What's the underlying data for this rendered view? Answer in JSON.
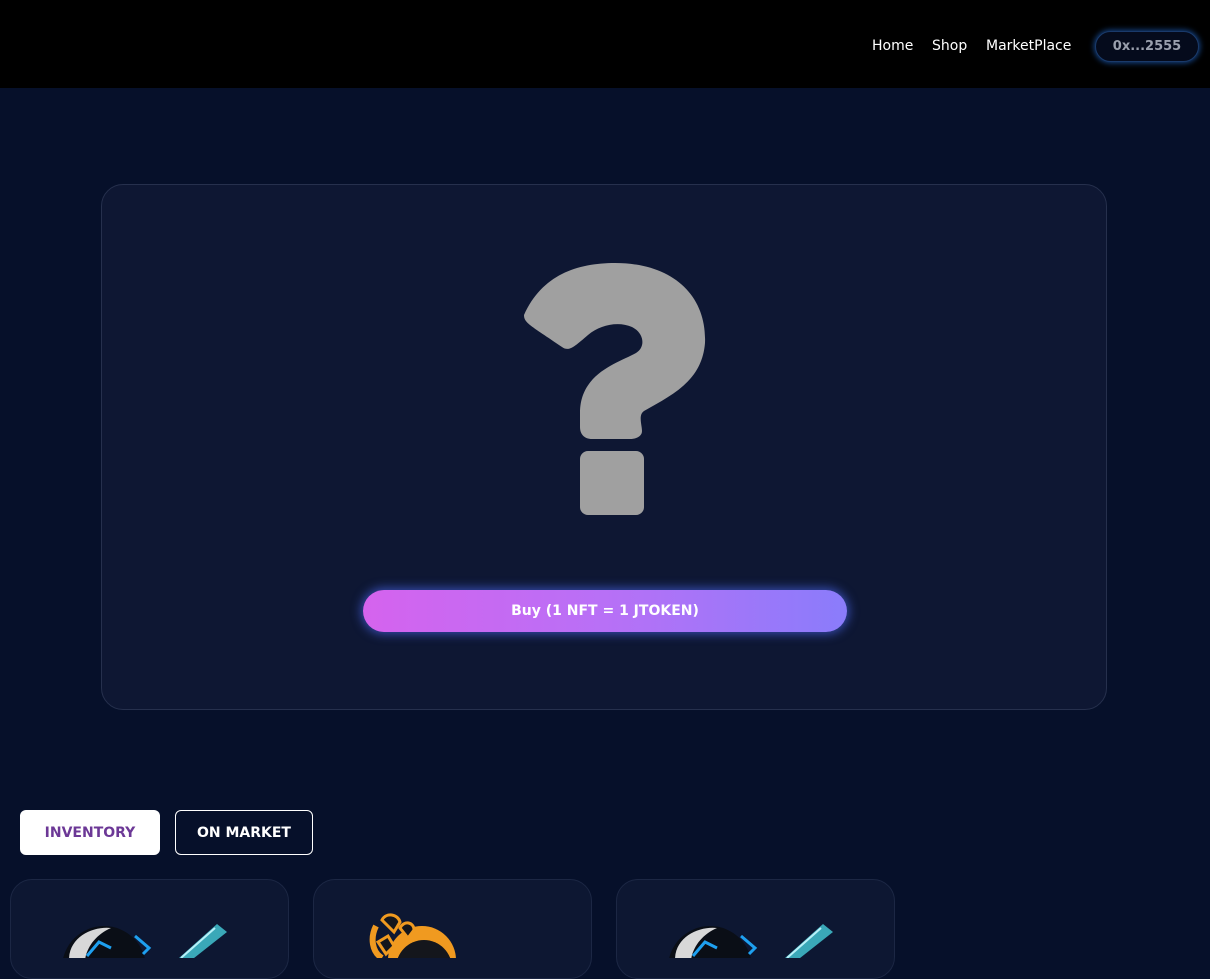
{
  "nav": {
    "home": "Home",
    "shop": "Shop",
    "marketplace": "MarketPlace",
    "wallet": "0x...2555"
  },
  "mystery_box": {
    "icon": "question-mark-icon",
    "buy_label": "Buy (1 NFT = 1 JTOKEN)"
  },
  "tabs": {
    "inventory": "INVENTORY",
    "on_market": "ON MARKET"
  },
  "inventory": {
    "items": [
      {
        "icon": "robot-blue-icon"
      },
      {
        "icon": "robot-orange-icon"
      },
      {
        "icon": "robot-blue-icon"
      }
    ]
  },
  "colors": {
    "background": "#06102a",
    "topbar": "#000000",
    "card": "#0e1733",
    "buy_gradient_start": "#d563ee",
    "buy_gradient_end": "#8a7cfb",
    "tab_active_text": "#6c3896",
    "question_mark": "#a0a0a0"
  }
}
